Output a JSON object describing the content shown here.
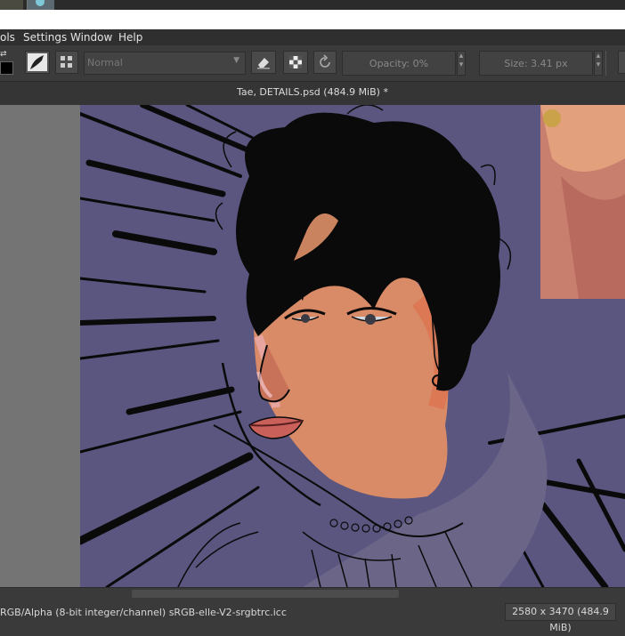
{
  "menu": {
    "items": [
      {
        "label": "ols"
      },
      {
        "label": "Settings"
      },
      {
        "label": "Window"
      },
      {
        "label": "Help"
      }
    ]
  },
  "toolbar": {
    "blend_mode": "Normal",
    "opacity": "Opacity: 0%",
    "size": "Size: 3.41 px"
  },
  "document": {
    "title": "Tae, DETAILS.psd (484.9 MiB) *"
  },
  "status": {
    "color_info": "RGB/Alpha (8-bit integer/channel)  sRGB-elle-V2-srgbtrc.icc",
    "dimensions": "2580 x 3470 (484.9 MiB)"
  },
  "colors": {
    "canvas_background": "#5a5680",
    "hair": "#0a0a0a",
    "skin": "#d98a66",
    "lips": "#c9605a"
  }
}
